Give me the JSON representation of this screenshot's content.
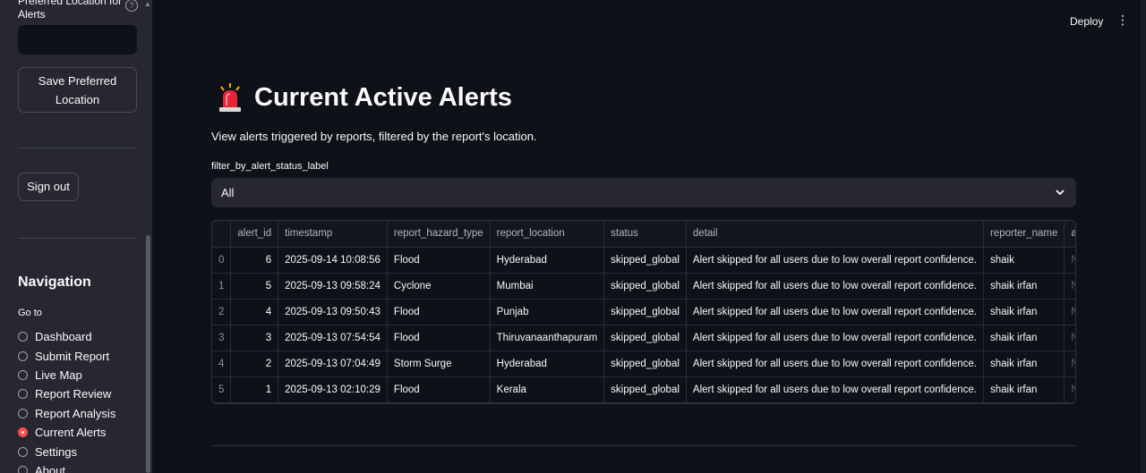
{
  "sidebar": {
    "location_label_cut": "Preferred Location for",
    "location_label_line2": "Alerts",
    "location_input_value": "",
    "save_button": "Save Preferred Location",
    "save_button_line1": "Save Preferred",
    "save_button_line2": "Location",
    "sign_out": "Sign out",
    "navigation_title": "Navigation",
    "goto_label": "Go to",
    "nav_items": [
      "Dashboard",
      "Submit Report",
      "Live Map",
      "Report Review",
      "Report Analysis",
      "Current Alerts",
      "Settings",
      "About"
    ],
    "selected_item": "Current Alerts"
  },
  "header": {
    "deploy": "Deploy"
  },
  "main": {
    "title": "Current Active Alerts",
    "subtitle": "View alerts triggered by reports, filtered by the report's location.",
    "filter_label": "filter_by_alert_status_label",
    "filter_value": "All"
  },
  "table": {
    "columns": [
      "",
      "alert_id",
      "timestamp",
      "report_hazard_type",
      "report_location",
      "status",
      "detail",
      "reporter_name",
      "alert_"
    ],
    "rows": [
      [
        "0",
        "6",
        "2025-09-14 10:08:56",
        "Flood",
        "Hyderabad",
        "skipped_global",
        "Alert skipped for all users due to low overall report confidence.",
        "shaik",
        "None"
      ],
      [
        "1",
        "5",
        "2025-09-13 09:58:24",
        "Cyclone",
        "Mumbai",
        "skipped_global",
        "Alert skipped for all users due to low overall report confidence.",
        "shaik irfan",
        "None"
      ],
      [
        "2",
        "4",
        "2025-09-13 09:50:43",
        "Flood",
        "Punjab",
        "skipped_global",
        "Alert skipped for all users due to low overall report confidence.",
        "shaik irfan",
        "None"
      ],
      [
        "3",
        "3",
        "2025-09-13 07:54:54",
        "Flood",
        "Thiruvanaanthapuram",
        "skipped_global",
        "Alert skipped for all users due to low overall report confidence.",
        "shaik irfan",
        "None"
      ],
      [
        "4",
        "2",
        "2025-09-13 07:04:49",
        "Storm Surge",
        "Hyderabad",
        "skipped_global",
        "Alert skipped for all users due to low overall report confidence.",
        "shaik irfan",
        "None"
      ],
      [
        "5",
        "1",
        "2025-09-13 02:10:29",
        "Flood",
        "Kerala",
        "skipped_global",
        "Alert skipped for all users due to low overall report confidence.",
        "shaik irfan",
        "None"
      ]
    ]
  },
  "colors": {
    "accent": "#ff4b4b",
    "background": "#0e1117",
    "sidebar": "#262730"
  },
  "icons": [
    "help-icon",
    "siren-icon",
    "chevron-down-icon",
    "kebab-menu-icon"
  ]
}
